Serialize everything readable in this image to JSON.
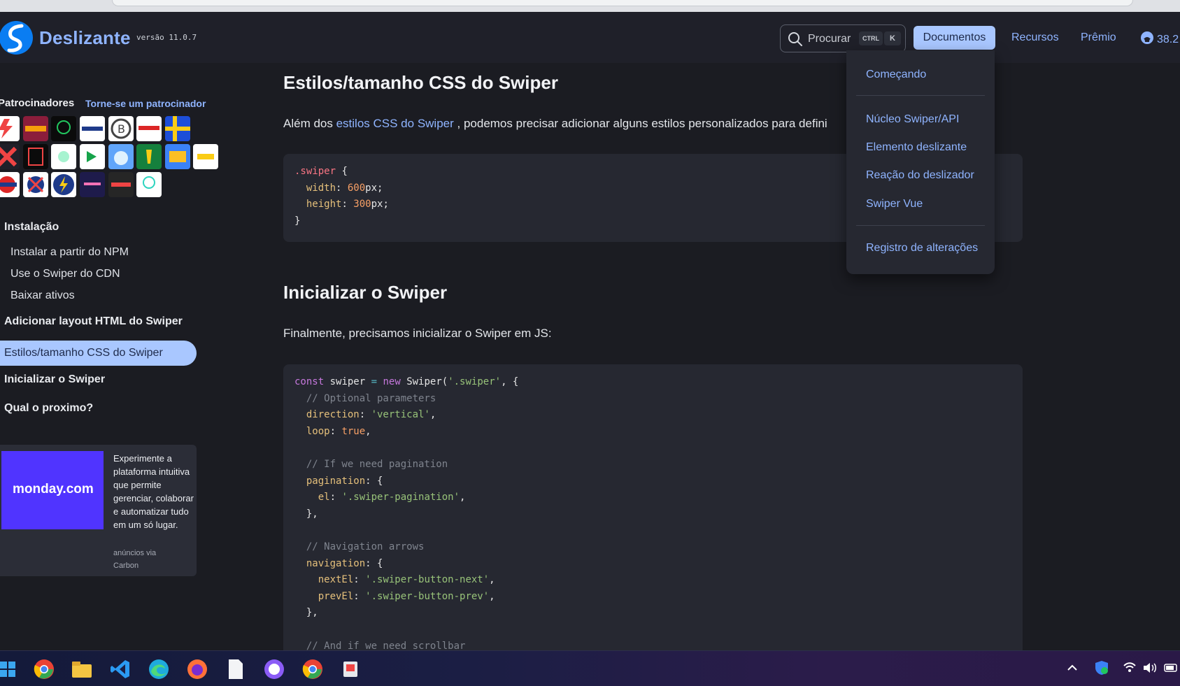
{
  "navbar": {
    "brand": "Deslizante",
    "version": "versão 11.0.7",
    "search_placeholder": "Procurar",
    "search_kbd_ctrl": "CTRL",
    "search_kbd_k": "K",
    "links": {
      "documentos": "Documentos",
      "recursos": "Recursos",
      "premio": "Prêmio"
    },
    "github_stars": "38.2"
  },
  "dropdown": {
    "items": [
      "Começando",
      "Núcleo Swiper/API",
      "Elemento deslizante",
      "Reação do deslizador",
      "Swiper Vue",
      "Registro de alterações"
    ]
  },
  "sidebar": {
    "sponsors_title": "Patrocinadores",
    "sponsors_link": "Torne-se um patrocinador",
    "sections": {
      "instalacao": "Instalação",
      "npm": "Instalar a partir do NPM",
      "cdn": "Use o Swiper do CDN",
      "assets": "Baixar ativos",
      "html_layout": "Adicionar layout HTML do Swiper",
      "css_styles": "Estilos/tamanho CSS do Swiper",
      "init": "Inicializar o Swiper",
      "next": "Qual o proximo?"
    },
    "ad": {
      "brand": "monday.com",
      "text": "Experimente a plataforma intuitiva que permite gerenciar, colaborar e automatizar tudo em um só lugar.",
      "via": "anúncios via Carbon"
    }
  },
  "main": {
    "section1_title": "Estilos/tamanho CSS do Swiper",
    "section1_para_before": "Além dos ",
    "section1_para_link": "estilos CSS do Swiper",
    "section1_para_after": " , podemos precisar adicionar alguns estilos personalizados para defini",
    "section2_title": "Inicializar o Swiper",
    "section2_para": "Finalmente, precisamos inicializar o Swiper em JS:"
  },
  "taskbar": {
    "icons": [
      "windows-start",
      "chrome",
      "file-explorer",
      "vscode",
      "edge",
      "firefox",
      "notepad",
      "github-desktop",
      "chrome",
      "snipping-tool"
    ]
  },
  "colors": {
    "accent": "#8fb4ff",
    "active_bg": "#a9c7ff",
    "page_bg": "#1b1c22",
    "code_bg": "#262831"
  }
}
